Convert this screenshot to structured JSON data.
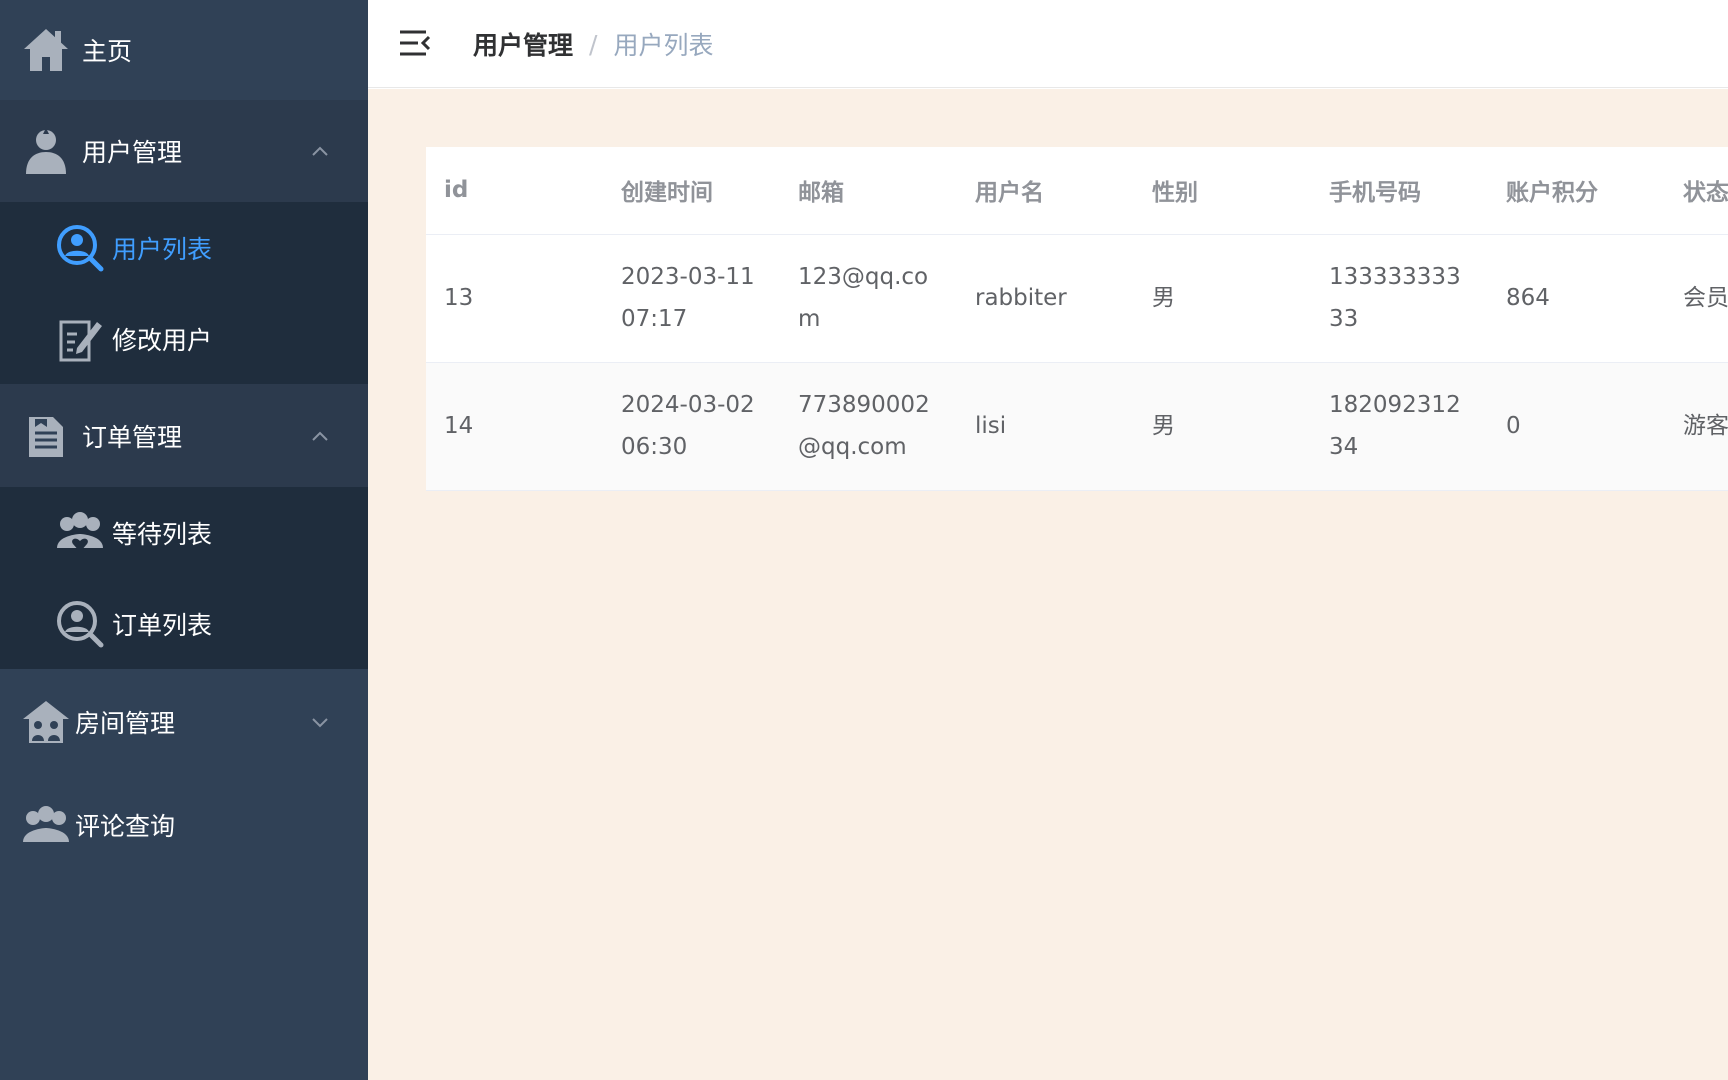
{
  "sidebar": {
    "home": {
      "label": "主页",
      "icon": "home-icon"
    },
    "user_mgmt": {
      "label": "用户管理",
      "icon": "user-icon",
      "expanded": true,
      "items": [
        {
          "label": "用户列表",
          "icon": "user-search-icon",
          "active": true
        },
        {
          "label": "修改用户",
          "icon": "edit-document-icon",
          "active": false
        }
      ]
    },
    "order_mgmt": {
      "label": "订单管理",
      "icon": "clipboard-icon",
      "expanded": true,
      "items": [
        {
          "label": "等待列表",
          "icon": "users-heart-icon",
          "active": false
        },
        {
          "label": "订单列表",
          "icon": "user-search-icon",
          "active": false
        }
      ]
    },
    "room_mgmt": {
      "label": "房间管理",
      "icon": "house-people-icon",
      "expanded": false
    },
    "comments": {
      "label": "评论查询",
      "icon": "users-group-icon"
    }
  },
  "header": {
    "breadcrumb": {
      "parent": "用户管理",
      "separator": "/",
      "current": "用户列表"
    }
  },
  "table": {
    "columns": [
      "id",
      "创建时间",
      "邮箱",
      "用户名",
      "性别",
      "手机号码",
      "账户积分",
      "状态"
    ],
    "rows": [
      [
        "13",
        "2023-03-11 07:17",
        "123@qq.com",
        "rabbiter",
        "男",
        "13333333333",
        "864",
        "会员"
      ],
      [
        "14",
        "2024-03-02 06:30",
        "773890002@qq.com",
        "lisi",
        "男",
        "18209231234",
        "0",
        "游客"
      ]
    ]
  },
  "colors": {
    "sidebar_bg": "#304156",
    "submenu_bg": "#1f2d3d",
    "active_text": "#409eff",
    "content_bg": "#faf0e6"
  }
}
